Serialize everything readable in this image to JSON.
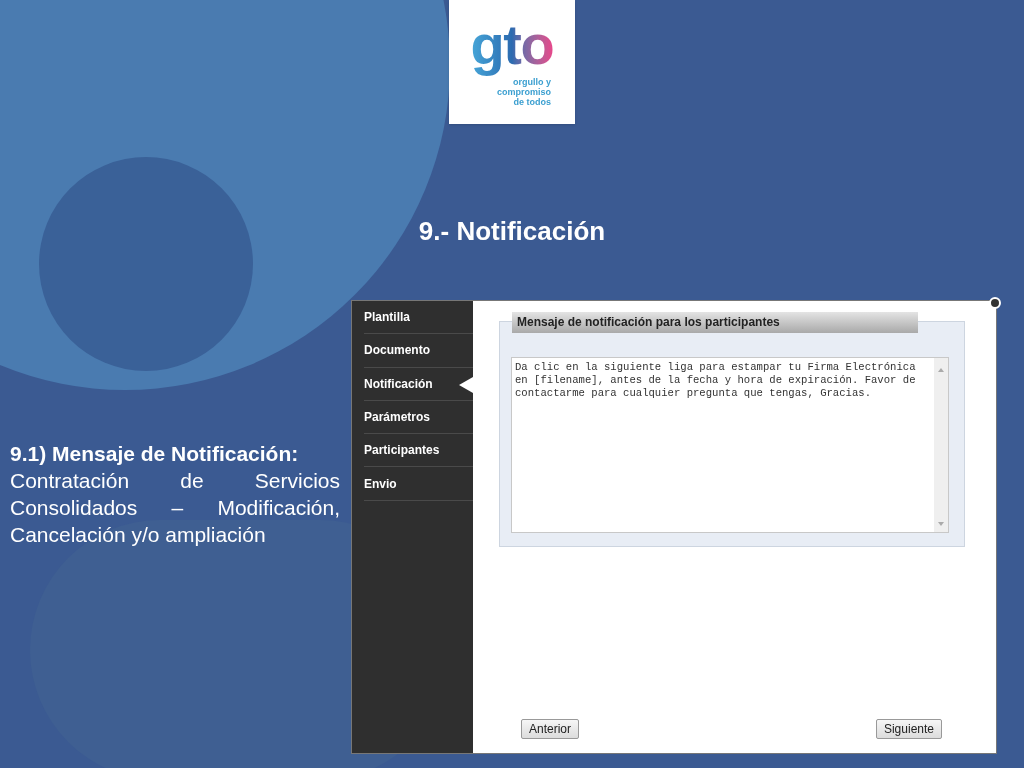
{
  "logo": {
    "mark": "gto",
    "tagline": [
      "orgullo y",
      "compromiso",
      "de todos"
    ]
  },
  "title": "9.- Notificación",
  "caption": {
    "heading": "9.1) Mensaje de Notificación:",
    "text": "Contratación de Servicios Consolidados – Modificación, Cancelación y/o ampliación"
  },
  "app": {
    "sidebar": [
      {
        "label": "Plantilla",
        "selected": false
      },
      {
        "label": "Documento",
        "selected": false
      },
      {
        "label": "Notificación",
        "selected": true
      },
      {
        "label": "Parámetros",
        "selected": false
      },
      {
        "label": "Participantes",
        "selected": false
      },
      {
        "label": "Envio",
        "selected": false
      }
    ],
    "panel_title": "Mensaje de notificación para los participantes",
    "message": "Da clic en la siguiente liga para estampar tu Firma Electrónica en [filename], antes de la fecha y hora de expiración. Favor de contactarme para cualquier pregunta que tengas, Gracias.",
    "buttons": [
      "Anterior",
      "Siguiente"
    ]
  }
}
